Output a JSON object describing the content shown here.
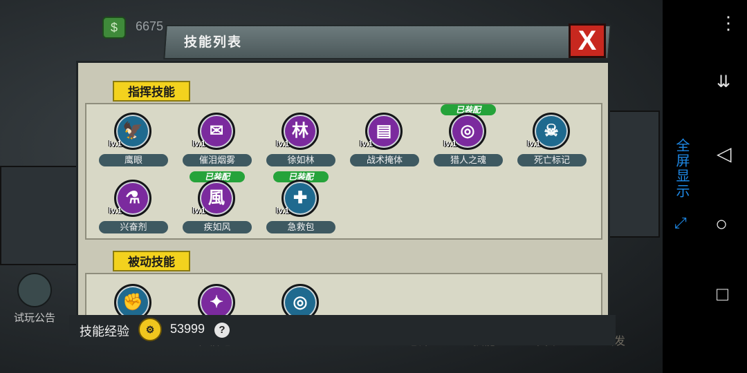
{
  "hud": {
    "top_currency_value": "6675",
    "notice_label": "试玩公告",
    "coin_icon": "money-icon"
  },
  "bottom_nav": [
    "住宿地",
    "仓库",
    "技能",
    "英雄",
    "出发"
  ],
  "dialog": {
    "title": "技能列表",
    "close_label": "X",
    "sections": [
      {
        "label": "指挥技能",
        "skills": [
          {
            "name": "鹰眼",
            "level": "lv.1",
            "glyph": "🦅",
            "color": "blue",
            "equipped": false
          },
          {
            "name": "催泪烟雾",
            "level": "lv.1",
            "glyph": "✉",
            "color": "purple",
            "equipped": false
          },
          {
            "name": "徐如林",
            "level": "lv.1",
            "glyph": "林",
            "color": "purple",
            "equipped": false
          },
          {
            "name": "战术掩体",
            "level": "lv.1",
            "glyph": "▤",
            "color": "purple",
            "equipped": false
          },
          {
            "name": "猎人之魂",
            "level": "lv.1",
            "glyph": "◎",
            "color": "purple",
            "equipped": true
          },
          {
            "name": "死亡标记",
            "level": "lv.1",
            "glyph": "☠",
            "color": "blue",
            "equipped": false
          },
          {
            "name": "兴奋剂",
            "level": "lv.1",
            "glyph": "⚗",
            "color": "purple",
            "equipped": false
          },
          {
            "name": "疾如风",
            "level": "lv.1",
            "glyph": "風",
            "color": "purple",
            "equipped": true
          },
          {
            "name": "急救包",
            "level": "lv.1",
            "glyph": "✚",
            "color": "blue",
            "equipped": true
          }
        ]
      },
      {
        "label": "被动技能",
        "skills": [
          {
            "glyph": "✊",
            "color": "blue"
          },
          {
            "glyph": "✦",
            "color": "purple"
          },
          {
            "glyph": "◎",
            "color": "blue"
          }
        ]
      }
    ],
    "equipped_label": "已装配"
  },
  "footer": {
    "exp_label": "技能经验",
    "exp_value": "53999",
    "help_label": "?"
  },
  "system_bar": {
    "fullscreen_label": "全屏显示"
  }
}
